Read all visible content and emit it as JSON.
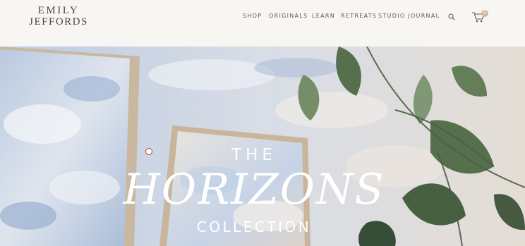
{
  "brand": {
    "line1": "EMILY",
    "line2": "JEFFORDS"
  },
  "nav": {
    "items": [
      {
        "label": "SHOP"
      },
      {
        "label": "ORIGINALS"
      },
      {
        "label": "LEARN"
      },
      {
        "label": "RETREATS"
      },
      {
        "label": "STUDIO JOURNAL"
      }
    ]
  },
  "cart": {
    "count": "0"
  },
  "hero": {
    "line1": "THE",
    "line2": "HORIZONS",
    "line3": "COLLECTION"
  },
  "colors": {
    "text": "#4b4744",
    "badge": "#d1b9a6",
    "hero_text": "#ffffff"
  },
  "icons": {
    "search": "search-icon",
    "cart": "cart-icon"
  }
}
